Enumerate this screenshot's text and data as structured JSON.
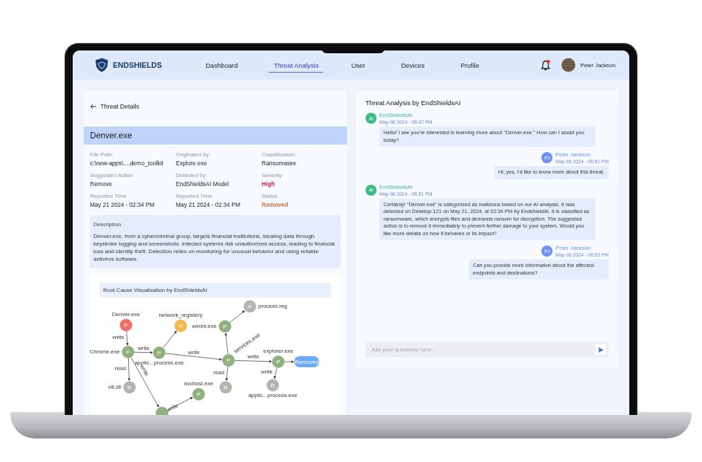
{
  "brand": {
    "name": "ENDSHIELDS"
  },
  "nav": [
    {
      "label": "Dashboard",
      "selected": false
    },
    {
      "label": "Threat Analysis",
      "selected": true
    },
    {
      "label": "User",
      "selected": false
    },
    {
      "label": "Devices",
      "selected": false
    },
    {
      "label": "Profile",
      "selected": false
    }
  ],
  "user": {
    "name": "Peter Jackson"
  },
  "threat": {
    "back_title": "Threat Details",
    "name": "Denver.exe",
    "fields": [
      {
        "label": "File Path:",
        "value": "c:\\new-apps\\....demo_toolkit"
      },
      {
        "label": "Originated by:",
        "value": "Explore.exe"
      },
      {
        "label": "Classification:",
        "value": "Ransomware"
      },
      {
        "label": "Suggested Action",
        "value": "Remove"
      },
      {
        "label": "Detected by:",
        "value": "EndShieldsAI Model"
      },
      {
        "label": "Severity",
        "value": "High",
        "color": "#d21d4b"
      },
      {
        "label": "Reported Time",
        "value": "May 21 2024 - 02:34 PM"
      },
      {
        "label": "Reported Time",
        "value": "May 21 2024 - 02:34 PM"
      },
      {
        "label": "Status",
        "value": "Removed",
        "color": "#c8744a"
      }
    ],
    "description": {
      "title": "Description",
      "text": "Denver.exe, from a cybercriminal group, targets financial institutions, stealing data through keystroke logging and screenshots. Infected systems risk unauthorized access, leading to financial loss and identity theft. Detection relies on monitoring for unusual behavior and using reliable antivirus software."
    }
  },
  "graph": {
    "title": "Root Cause Visualisation by EndShieldsAI",
    "nodes": [
      {
        "kind": "circle",
        "letter": "P",
        "label": "Denver.exe",
        "color": "#f07068"
      },
      {
        "kind": "circle",
        "letter": "P",
        "label": "Chrome.exe",
        "color": "#8fb07f"
      },
      {
        "kind": "circle",
        "letter": "P",
        "label": "applic...process.exe",
        "color": "#8fb07f"
      },
      {
        "kind": "circle",
        "letter": "R",
        "label": "network_registery",
        "color": "#f7b84a"
      },
      {
        "kind": "circle",
        "letter": "P",
        "label": "winint.exe",
        "color": "#8fb07f"
      },
      {
        "kind": "circle",
        "letter": "R",
        "label": "process.reg",
        "color": "#b3b3b0"
      },
      {
        "kind": "circle",
        "letter": "P",
        "label": "services.exe",
        "color": "#8fb07f"
      },
      {
        "kind": "circle",
        "letter": "P",
        "label": "explorer.exe",
        "color": "#8fb07f"
      },
      {
        "kind": "pill",
        "letter": "Removed",
        "color": "#6aaaf6"
      },
      {
        "kind": "circle",
        "letter": "R",
        "label": "v8.dll",
        "color": "#b3b3b0"
      },
      {
        "kind": "circle",
        "letter": "P",
        "label": "svchost.exe",
        "color": "#8fb07f"
      },
      {
        "kind": "circle",
        "letter": "R",
        "color": "#b3b3b0"
      },
      {
        "kind": "circle",
        "letter": "R",
        "label": "applic...process.exe",
        "color": "#b3b3b0"
      },
      {
        "kind": "circle",
        "color": "#8fb07f"
      }
    ],
    "edge_labels": [
      "write",
      "write",
      "write",
      "write",
      "write",
      "read",
      "read",
      "write",
      "write"
    ]
  },
  "chat": {
    "title": "Threat Analysis by EndShieldsAI",
    "messages": [
      {
        "kind": "ai",
        "initials": "AI",
        "name": "EndShieldsAI",
        "time": "May 06 2024 - 06:47 PM",
        "text": "Hello! I see you're interested in learning more about \"Denver.exe.\" How can I assist you today?"
      },
      {
        "kind": "user",
        "initials": "PJ",
        "name": "Peter Jackson",
        "time": "May 06 2024 - 06:51 PM",
        "text": "Hi, yes, I'd like to know more about this threat."
      },
      {
        "kind": "ai",
        "initials": "AI",
        "name": "EndShieldsAI",
        "time": "May 06 2024 - 06:51 PM",
        "text": "Certainly! \"Denver.exe\" is categorized as malicious based on our AI analysis. It was detected on Desktop-121 on May 21, 2024, at 02:34 PM by EndshieldAI. It is classified as ransomware, which encrypts files and demands ransom for decryption. The suggested action is to remove it immediately to prevent further damage to your system. Would you like more details on how it behaves or its impact?"
      },
      {
        "kind": "user",
        "initials": "PJ",
        "name": "Peter Jackson",
        "time": "May 06 2024 - 06:53 PM",
        "text": "Can you provide more information about the affected endpoints and destinations?"
      }
    ],
    "input": {
      "placeholder": "Ask your questions here..."
    }
  }
}
